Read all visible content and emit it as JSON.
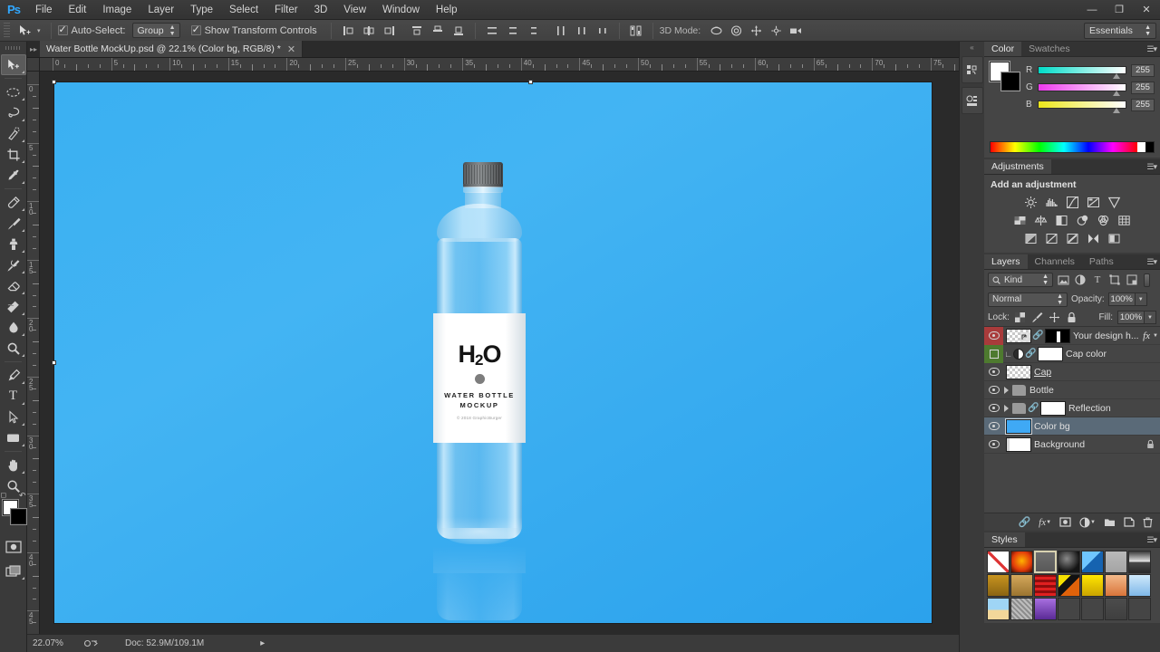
{
  "app": {
    "logo": "Ps",
    "workspace": "Essentials"
  },
  "menu": {
    "items": [
      "File",
      "Edit",
      "Image",
      "Layer",
      "Type",
      "Select",
      "Filter",
      "3D",
      "View",
      "Window",
      "Help"
    ]
  },
  "window_controls": {
    "minimize": "—",
    "maximize": "❐",
    "close": "✕"
  },
  "options_bar": {
    "tool_icon": "move-tool",
    "auto_select_label": "Auto-Select:",
    "auto_select_checked": true,
    "auto_select_scope": "Group",
    "show_transform_label": "Show Transform Controls",
    "show_transform_checked": true,
    "align_group_1": [
      "align-left-edges",
      "align-horizontal-centers",
      "align-right-edges"
    ],
    "align_group_2": [
      "align-top-edges",
      "align-vertical-centers",
      "align-bottom-edges"
    ],
    "distribute_group_1": [
      "distribute-top-edges",
      "distribute-vertical-centers",
      "distribute-bottom-edges"
    ],
    "distribute_group_2": [
      "distribute-left-edges",
      "distribute-horizontal-centers",
      "distribute-right-edges"
    ],
    "auto_align_label": "auto-align-layers",
    "mode_3d_label": "3D Mode:",
    "mode_3d_icons": [
      "rotate-3d-icon",
      "roll-3d-icon",
      "pan-3d-icon",
      "slide-3d-icon",
      "scale-3d-icon"
    ]
  },
  "toolbar": {
    "tools": [
      {
        "name": "move-tool",
        "selected": true
      },
      {
        "name": "rectangular-marquee-tool",
        "selected": false
      },
      {
        "name": "lasso-tool",
        "selected": false
      },
      {
        "name": "quick-selection-tool",
        "selected": false
      },
      {
        "name": "crop-tool",
        "selected": false
      },
      {
        "name": "eyedropper-tool",
        "selected": false
      },
      {
        "name": "spot-healing-brush-tool",
        "selected": false
      },
      {
        "name": "brush-tool",
        "selected": false
      },
      {
        "name": "clone-stamp-tool",
        "selected": false
      },
      {
        "name": "history-brush-tool",
        "selected": false
      },
      {
        "name": "eraser-tool",
        "selected": false
      },
      {
        "name": "gradient-tool",
        "selected": false
      },
      {
        "name": "blur-tool",
        "selected": false
      },
      {
        "name": "dodge-tool",
        "selected": false
      },
      {
        "name": "pen-tool",
        "selected": false
      },
      {
        "name": "horizontal-type-tool",
        "selected": false
      },
      {
        "name": "path-selection-tool",
        "selected": false
      },
      {
        "name": "rectangle-tool",
        "selected": false
      },
      {
        "name": "hand-tool",
        "selected": false
      },
      {
        "name": "zoom-tool",
        "selected": false
      }
    ],
    "foreground_color": "#ffffff",
    "background_color": "#000000",
    "quick_mask": "edit-in-quick-mask-mode",
    "screen_mode": "change-screen-mode"
  },
  "document": {
    "tab_title": "Water Bottle MockUp.psd @ 22.1% (Color bg, RGB/8) *",
    "close_glyph": "✕"
  },
  "rulers": {
    "horizontal": [
      "0",
      "5",
      "10",
      "15",
      "20",
      "25",
      "30",
      "35",
      "40",
      "45",
      "50",
      "55",
      "60",
      "65",
      "70",
      "75"
    ],
    "vertical": [
      "0",
      "5",
      "10",
      "15",
      "20",
      "25",
      "30",
      "35",
      "40",
      "45"
    ]
  },
  "canvas": {
    "background_color": "#3fa9f5",
    "label": {
      "title": "H",
      "subscript": "2",
      "title_end": "O",
      "line1": "WATER BOTTLE",
      "line2": "MOCKUP",
      "copyright": "© 2018 GraphicBurger"
    },
    "cap_color": "#6e7274"
  },
  "status_bar": {
    "zoom": "22.07%",
    "doc": "Doc: 52.9M/109.1M",
    "arrow": "▸"
  },
  "dock_rail": {
    "collapse_glyph": "«",
    "buttons": [
      "history-panel-icon",
      "properties-panel-icon"
    ]
  },
  "color_panel": {
    "tabs": [
      {
        "label": "Color",
        "active": true
      },
      {
        "label": "Swatches",
        "active": false
      }
    ],
    "channels": [
      {
        "label": "R",
        "value": "255"
      },
      {
        "label": "G",
        "value": "255"
      },
      {
        "label": "B",
        "value": "255"
      }
    ],
    "foreground": "#ffffff",
    "background": "#000000"
  },
  "adjustments_panel": {
    "tab": "Adjustments",
    "title": "Add an adjustment",
    "row1": [
      "brightness-contrast-icon",
      "levels-icon",
      "curves-icon",
      "exposure-icon",
      "vibrance-icon"
    ],
    "row2": [
      "hue-saturation-icon",
      "color-balance-icon",
      "black-white-icon",
      "photo-filter-icon",
      "channel-mixer-icon",
      "color-lookup-icon"
    ],
    "row3": [
      "invert-icon",
      "posterize-icon",
      "threshold-icon",
      "selective-color-icon",
      "gradient-map-icon"
    ]
  },
  "layers_panel": {
    "tabs": [
      {
        "label": "Layers",
        "active": true
      },
      {
        "label": "Channels",
        "active": false
      },
      {
        "label": "Paths",
        "active": false
      }
    ],
    "filter_kind": "Kind",
    "filter_icons": [
      "filter-pixel-icon",
      "filter-adjustment-icon",
      "filter-type-icon",
      "filter-shape-icon",
      "filter-smart-object-icon"
    ],
    "blend_mode": "Normal",
    "opacity_label": "Opacity:",
    "opacity_value": "100%",
    "lock_label": "Lock:",
    "lock_icons": [
      "lock-transparent-pixels-icon",
      "lock-image-pixels-icon",
      "lock-position-icon",
      "lock-all-icon"
    ],
    "fill_label": "Fill:",
    "fill_value": "100%",
    "layers": [
      {
        "name": "Your design h...",
        "visible": true,
        "highlight": "red",
        "thumb": "checker",
        "mask": "black",
        "has_fx": true,
        "linked": true,
        "type": "smart-object"
      },
      {
        "name": "Cap color",
        "visible": false,
        "highlight": "green",
        "thumb": "adjustment",
        "mask": "white",
        "clipped": true,
        "linked": true,
        "type": "adjustment"
      },
      {
        "name": "Cap",
        "visible": true,
        "highlight": "none",
        "thumb": "checker",
        "type": "pixel",
        "underline": true
      },
      {
        "name": "Bottle",
        "visible": true,
        "highlight": "none",
        "thumb": "folder",
        "type": "group"
      },
      {
        "name": "Reflection",
        "visible": true,
        "highlight": "none",
        "thumb": "folder",
        "mask": "white",
        "linked": true,
        "type": "group"
      },
      {
        "name": "Color bg",
        "visible": true,
        "highlight": "none",
        "thumb": "blue",
        "type": "fill",
        "selected": true
      },
      {
        "name": "Background",
        "visible": true,
        "highlight": "none",
        "thumb": "white",
        "type": "background",
        "locked": true
      }
    ],
    "bottom_buttons": [
      "link-layers-icon",
      "layer-style-fx-icon",
      "add-layer-mask-icon",
      "new-fill-adjustment-icon",
      "new-group-icon",
      "new-layer-icon",
      "delete-layer-icon"
    ]
  },
  "styles_panel": {
    "tab": "Styles",
    "swatches": [
      {
        "name": "default-none",
        "css": "linear-gradient(#fff,#fff)",
        "selected": false,
        "slash": true
      },
      {
        "name": "sunspot",
        "css": "radial-gradient(circle at 50% 45%, #ffb300, #e23a0a 60%, #3a0a00)",
        "selected": false
      },
      {
        "name": "blue-gel",
        "css": "linear-gradient(#6f6f6f,#585858)",
        "selected": true
      },
      {
        "name": "black-stone",
        "css": "radial-gradient(circle at 40% 35%, #8a8a8a, #141414 70%)",
        "selected": false
      },
      {
        "name": "blue-ribbon",
        "css": "linear-gradient(135deg,#6fc6ff 0 45%, #1663b0 45%)",
        "selected": false
      },
      {
        "name": "gray-matte",
        "css": "linear-gradient(#b9b9b9,#a4a4a4)",
        "selected": false
      },
      {
        "name": "chrome-bar",
        "css": "linear-gradient(#3c3c3c,#e6e6e6 48%,#4a4a4a 52%,#2a2a2a)",
        "selected": false
      },
      {
        "name": "amber-bevel",
        "css": "linear-gradient(#c8941f,#8a6412)",
        "selected": false
      },
      {
        "name": "sand-bevel",
        "css": "linear-gradient(#d4a85b,#9b7430)",
        "selected": false
      },
      {
        "name": "red-stripes",
        "css": "repeating-linear-gradient(0deg,#e02020 0 3px,#8f0d0d 3px 6px)",
        "selected": false
      },
      {
        "name": "confetti",
        "css": "linear-gradient(135deg,#f5e000 0 30%, #111 30% 55%, #e0620a 55%)",
        "selected": false
      },
      {
        "name": "yellow-glass",
        "css": "linear-gradient(#ffe600,#caa400)",
        "selected": false
      },
      {
        "name": "peach-gloss",
        "css": "linear-gradient(#f3b98a,#d9743a)",
        "selected": false
      },
      {
        "name": "ice-blue",
        "css": "linear-gradient(#cfe9fb,#7fb8e8)",
        "selected": false
      },
      {
        "name": "sky-horizon",
        "css": "linear-gradient(#9fd5f5 0 55%, #f2d79a 55%)",
        "selected": false
      },
      {
        "name": "noise-gray",
        "css": "repeating-linear-gradient(45deg,#bdbdbd 0 2px,#8d8d8d 2px 4px)",
        "selected": false
      },
      {
        "name": "violet-gloss",
        "css": "linear-gradient(#a86fe0,#5a2a96)",
        "selected": false
      },
      {
        "name": "drop-shadow-square",
        "css": "linear-gradient(#454545,#454545)",
        "selected": false
      },
      {
        "name": "outline-square",
        "css": "linear-gradient(#454545,#454545)",
        "selected": false
      },
      {
        "name": "inner-square",
        "css": "linear-gradient(#4c4c4c,#3f3f3f)",
        "selected": false
      },
      {
        "name": "empty-slot",
        "css": "linear-gradient(#454545,#454545)",
        "selected": false
      }
    ]
  }
}
